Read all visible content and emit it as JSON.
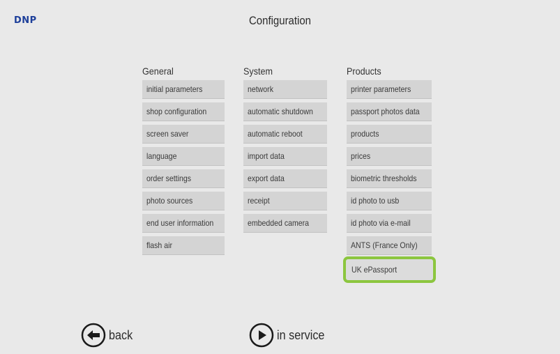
{
  "header": {
    "logo": "DNP",
    "title": "Configuration"
  },
  "columns": {
    "general": {
      "heading": "General",
      "items": [
        "initial parameters",
        "shop configuration",
        "screen saver",
        "language",
        "order settings",
        "photo sources",
        "end user information",
        "flash air"
      ]
    },
    "system": {
      "heading": "System",
      "items": [
        "network",
        "automatic shutdown",
        "automatic reboot",
        "import data",
        "export data",
        "receipt",
        "embedded camera"
      ]
    },
    "products": {
      "heading": "Products",
      "items": [
        "printer parameters",
        "passport photos data",
        "products",
        "prices",
        "biometric thresholds",
        "id photo to usb",
        "id photo via e-mail",
        "ANTS (France Only)",
        "UK ePassport"
      ],
      "selected_item": "UK ePassport"
    }
  },
  "footer": {
    "back_label": "back",
    "service_label": "in service",
    "back_icon": "arrow-left-circle-icon",
    "service_icon": "play-circle-icon"
  },
  "colors": {
    "background": "#e9e9e9",
    "button": "#d4d4d4",
    "highlight": "#8cc63f",
    "logo": "#1d3f9a"
  }
}
